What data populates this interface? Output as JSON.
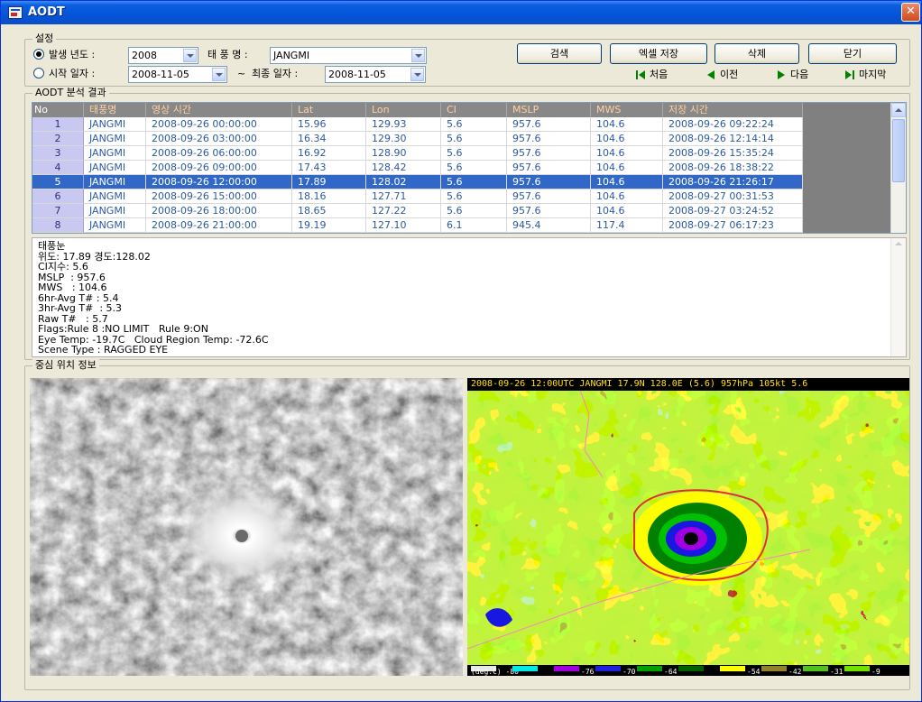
{
  "window": {
    "title": "AODT"
  },
  "settings": {
    "group_label": "설정",
    "radio_year_label": "발생 년도 :",
    "year_value": "2008",
    "typhoon_name_label": "태 풍 명 :",
    "typhoon_name_value": "JANGMI",
    "radio_date_label": "시작 일자 :",
    "start_date_value": "2008-11-05",
    "tilde": "~",
    "end_date_label": "최종 일자 :",
    "end_date_value": "2008-11-05"
  },
  "toolbar": {
    "search_label": "검색",
    "excel_save_label": "엑셀 저장",
    "delete_label": "삭제",
    "close_label": "닫기",
    "first_label": "처음",
    "prev_label": "이전",
    "next_label": "다음",
    "last_label": "마지막"
  },
  "results": {
    "group_label": "AODT 분석 결과",
    "columns": [
      "No",
      "태풍명",
      "영상 시간",
      "Lat",
      "Lon",
      "CI",
      "MSLP",
      "MWS",
      "저장 시간"
    ],
    "selected_index": 4,
    "rows": [
      [
        "1",
        "JANGMI",
        "2008-09-26 00:00:00",
        "15.96",
        "129.93",
        "5.6",
        "957.6",
        "104.6",
        "2008-09-26 09:22:24"
      ],
      [
        "2",
        "JANGMI",
        "2008-09-26 03:00:00",
        "16.34",
        "129.30",
        "5.6",
        "957.6",
        "104.6",
        "2008-09-26 12:14:14"
      ],
      [
        "3",
        "JANGMI",
        "2008-09-26 06:00:00",
        "16.92",
        "128.90",
        "5.6",
        "957.6",
        "104.6",
        "2008-09-26 15:35:24"
      ],
      [
        "4",
        "JANGMI",
        "2008-09-26 09:00:00",
        "17.43",
        "128.42",
        "5.6",
        "957.6",
        "104.6",
        "2008-09-26 18:38:22"
      ],
      [
        "5",
        "JANGMI",
        "2008-09-26 12:00:00",
        "17.89",
        "128.02",
        "5.6",
        "957.6",
        "104.6",
        "2008-09-26 21:26:17"
      ],
      [
        "6",
        "JANGMI",
        "2008-09-26 15:00:00",
        "18.16",
        "127.71",
        "5.6",
        "957.6",
        "104.6",
        "2008-09-27 00:31:53"
      ],
      [
        "7",
        "JANGMI",
        "2008-09-26 18:00:00",
        "18.65",
        "127.22",
        "5.6",
        "957.6",
        "104.6",
        "2008-09-27 03:24:52"
      ],
      [
        "8",
        "JANGMI",
        "2008-09-26 21:00:00",
        "19.19",
        "127.10",
        "6.1",
        "945.4",
        "117.4",
        "2008-09-27 06:17:23"
      ]
    ]
  },
  "detail": {
    "lines": [
      "태풍눈",
      "위도: 17.89 경도:128.02",
      "CI지수: 5.6",
      "MSLP  : 957.6",
      "MWS   : 104.6",
      "6hr-Avg T# : 5.4",
      "3hr-Avg T#  : 5.3",
      "Raw T#   : 5.7",
      "Flags:Rule 8 :NO LIMIT   Rule 9:ON",
      "Eye Temp: -19.7C   Cloud Region Temp: -72.6C",
      "Scene Type : RAGGED EYE"
    ]
  },
  "center_info": {
    "group_label": "중심 위치 정보",
    "enhanced_header": "2008-09-26 12:00UTC JANGMI 17.9N 128.0E  (5.6) 957hPa 105kt  5.6",
    "legend": [
      {
        "label": "(deg.C) -80",
        "color": "#e8e8e8"
      },
      {
        "label": "",
        "color": "#00e8e8"
      },
      {
        "label": "-76",
        "color": "#a000e0"
      },
      {
        "label": "-70",
        "color": "#2020e0"
      },
      {
        "label": "-64",
        "color": "#00a000"
      },
      {
        "label": "",
        "color": "#006000"
      },
      {
        "label": "-54",
        "color": "#ffff00"
      },
      {
        "label": "-42",
        "color": "#908030"
      },
      {
        "label": "-31",
        "color": "#50c020"
      },
      {
        "label": "-9",
        "color": "#70e000"
      }
    ]
  },
  "colors": {
    "accent": "#3168c8",
    "header": "#888888",
    "row_index": "#c8c8f0"
  }
}
